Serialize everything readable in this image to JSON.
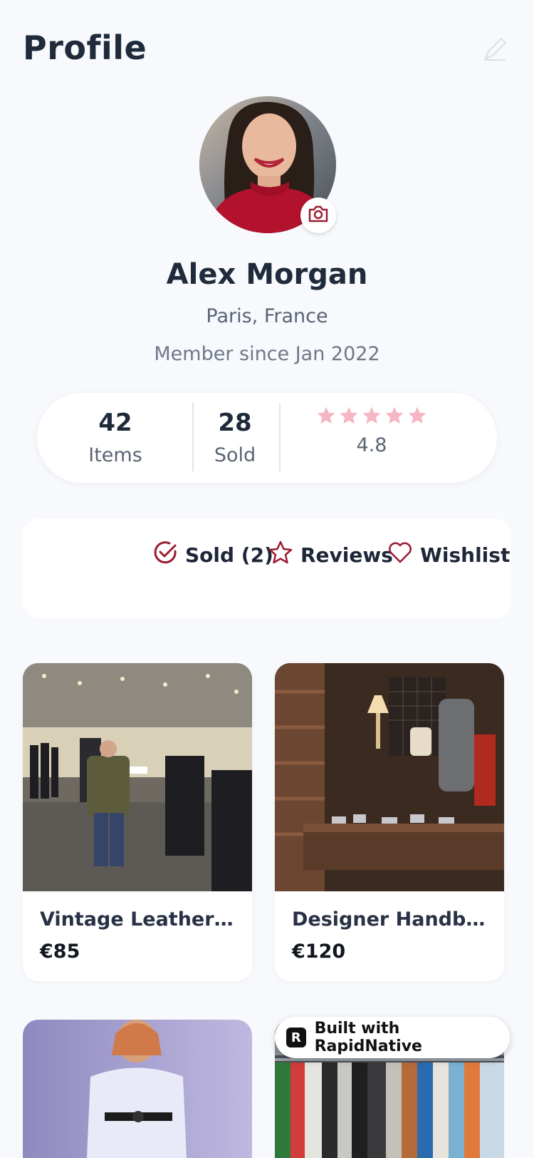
{
  "header": {
    "title": "Profile"
  },
  "profile": {
    "name": "Alex Morgan",
    "location": "Paris, France",
    "member_since": "Member since Jan 2022"
  },
  "stats": {
    "items": {
      "value": "42",
      "label": "Items"
    },
    "sold": {
      "value": "28",
      "label": "Sold"
    },
    "rating": {
      "value": "4.8",
      "stars": 5
    }
  },
  "tabs": [
    {
      "label": "Sold (2)",
      "icon": "check-circle-icon"
    },
    {
      "label": "Reviews",
      "icon": "star-outline-icon"
    },
    {
      "label": "Wishlist",
      "icon": "heart-outline-icon"
    }
  ],
  "listings": [
    {
      "title": "Vintage Leather J...",
      "price": "€85"
    },
    {
      "title": "Designer Handbag",
      "price": "€120"
    }
  ],
  "badge": {
    "text": "Built with RapidNative",
    "logo": "R"
  },
  "colors": {
    "accent": "#9b1b30",
    "star": "#f7b6c4",
    "background": "#f7f9fc"
  }
}
